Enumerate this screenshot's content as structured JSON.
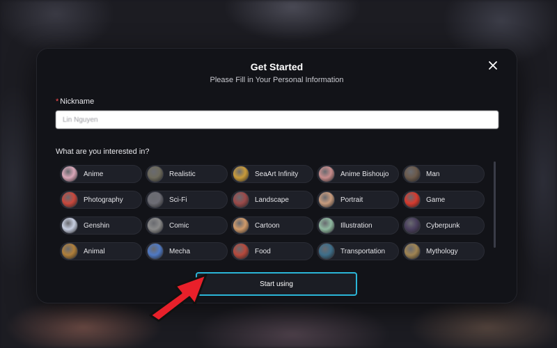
{
  "modal": {
    "title": "Get Started",
    "subtitle": "Please Fill in Your Personal Information",
    "close_icon": "close-icon"
  },
  "nickname": {
    "required_mark": "*",
    "label": "Nickname",
    "value": "Lin Nguyen"
  },
  "interests": {
    "label": "What are you interested in?",
    "items": [
      {
        "label": "Anime",
        "color": "#d9a6b8"
      },
      {
        "label": "Realistic",
        "color": "#6d6a5c"
      },
      {
        "label": "SeaArt Infinity",
        "color": "#c89a3a"
      },
      {
        "label": "Anime Bishoujo",
        "color": "#c78c8c"
      },
      {
        "label": "Man",
        "color": "#6b5a4c"
      },
      {
        "label": "Photography",
        "color": "#c9483d"
      },
      {
        "label": "Sci-Fi",
        "color": "#6d6d75"
      },
      {
        "label": "Landscape",
        "color": "#9b4a4a"
      },
      {
        "label": "Portrait",
        "color": "#c79b7e"
      },
      {
        "label": "Game",
        "color": "#d63a2e"
      },
      {
        "label": "Genshin",
        "color": "#c6cde0"
      },
      {
        "label": "Comic",
        "color": "#8a8a8a"
      },
      {
        "label": "Cartoon",
        "color": "#d09a6a"
      },
      {
        "label": "Illustration",
        "color": "#8fb8a0"
      },
      {
        "label": "Cyberpunk",
        "color": "#4a3f5e"
      },
      {
        "label": "Animal",
        "color": "#b07f3a"
      },
      {
        "label": "Mecha",
        "color": "#4f79c4"
      },
      {
        "label": "Food",
        "color": "#b6493c"
      },
      {
        "label": "Transportation",
        "color": "#3e6e8a"
      },
      {
        "label": "Mythology",
        "color": "#a08452"
      }
    ]
  },
  "start_button": {
    "label": "Start using"
  },
  "colors": {
    "accent_border": "#2bb6d8",
    "required": "#ff4d4f",
    "annotation_arrow": "#e8202a"
  }
}
